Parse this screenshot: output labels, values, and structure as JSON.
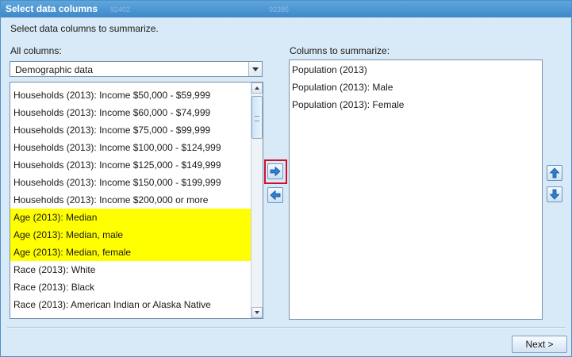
{
  "window": {
    "title": "Select data columns",
    "background_watermarks": [
      "92402",
      "92385"
    ]
  },
  "instruction": "Select data columns to summarize.",
  "left_panel": {
    "label": "All columns:",
    "dropdown_value": "Demographic data",
    "items": [
      {
        "label": "Households (2013): Income $50,000 - $59,999",
        "highlighted": false
      },
      {
        "label": "Households (2013): Income $60,000 - $74,999",
        "highlighted": false
      },
      {
        "label": "Households (2013): Income $75,000 - $99,999",
        "highlighted": false
      },
      {
        "label": "Households (2013): Income $100,000 - $124,999",
        "highlighted": false
      },
      {
        "label": "Households (2013): Income $125,000 - $149,999",
        "highlighted": false
      },
      {
        "label": "Households (2013): Income $150,000 - $199,999",
        "highlighted": false
      },
      {
        "label": "Households (2013): Income $200,000 or more",
        "highlighted": false
      },
      {
        "label": "Age (2013): Median",
        "highlighted": true
      },
      {
        "label": "Age (2013): Median, male",
        "highlighted": true
      },
      {
        "label": "Age (2013): Median, female",
        "highlighted": true
      },
      {
        "label": "Race (2013): White",
        "highlighted": false
      },
      {
        "label": "Race (2013): Black",
        "highlighted": false
      },
      {
        "label": "Race (2013): American Indian or Alaska Native",
        "highlighted": false
      }
    ],
    "highlight_color": "#ffff00"
  },
  "right_panel": {
    "label": "Columns to summarize:",
    "items": [
      "Population (2013)",
      "Population (2013): Male",
      "Population (2013): Female"
    ]
  },
  "transfer_buttons": {
    "add_icon": "arrow-right-icon",
    "remove_icon": "arrow-left-icon",
    "focus_color": "#d0102a"
  },
  "order_buttons": {
    "up_icon": "arrow-up-icon",
    "down_icon": "arrow-down-icon"
  },
  "footer": {
    "next_label": "Next >"
  },
  "colors": {
    "titlebar": "#3e88c9",
    "dialog_bg": "#d8eaf7",
    "accent_arrow": "#2f7fd0"
  }
}
